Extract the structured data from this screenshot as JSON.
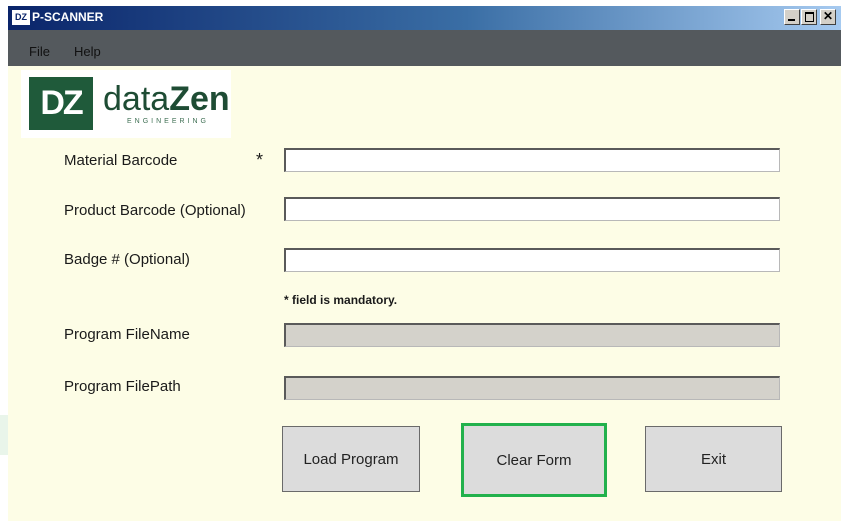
{
  "window": {
    "app_icon_text": "DZ",
    "title": "P-SCANNER",
    "controls": {
      "minimize": "minimize-icon",
      "maximize": "maximize-icon",
      "close": "close-icon"
    }
  },
  "menu": {
    "items": [
      "File",
      "Help"
    ]
  },
  "logo": {
    "mark": "DZ",
    "name_light": "data",
    "name_bold": "Zen",
    "subtitle": "ENGINEERING"
  },
  "form": {
    "material_barcode": {
      "label": "Material Barcode",
      "required_mark": "*",
      "value": ""
    },
    "product_barcode": {
      "label": "Product Barcode (Optional)",
      "value": ""
    },
    "badge": {
      "label": "Badge # (Optional)",
      "value": ""
    },
    "mandatory_note": "* field is mandatory.",
    "program_filename": {
      "label": "Program FileName",
      "value": ""
    },
    "program_filepath": {
      "label": "Program FilePath",
      "value": ""
    }
  },
  "buttons": {
    "load": "Load Program",
    "clear": "Clear Form",
    "exit": "Exit"
  },
  "colors": {
    "focus_ring": "#22b14c",
    "menubar": "#54595d",
    "form_background": "#fdfde6",
    "logo_green": "#1f5a3a"
  }
}
